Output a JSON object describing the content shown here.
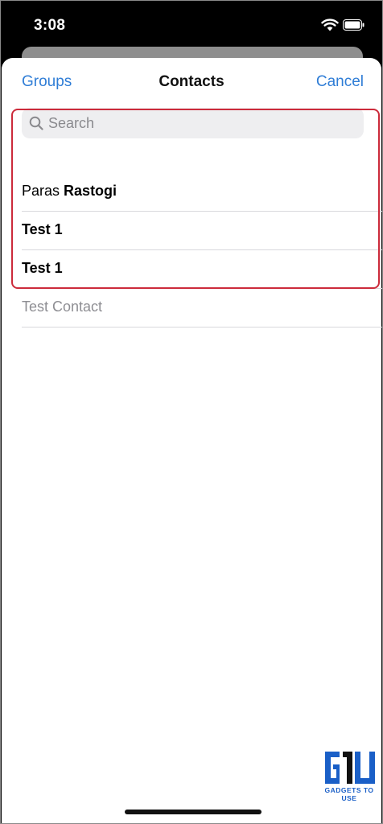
{
  "status_bar": {
    "time": "3:08",
    "icons": [
      "wifi-icon",
      "battery-icon"
    ]
  },
  "nav": {
    "left_label": "Groups",
    "title": "Contacts",
    "right_label": "Cancel"
  },
  "search": {
    "placeholder": "Search",
    "value": ""
  },
  "contacts": [
    {
      "first": "Paras",
      "last": "Rastogi"
    },
    {
      "first": "",
      "last": "Test 1"
    },
    {
      "first": "",
      "last": "Test 1"
    },
    {
      "first": "Test Contact",
      "last": "",
      "muted": true
    }
  ],
  "watermark": {
    "text": "GADGETS TO USE",
    "logo": "G1U"
  },
  "colors": {
    "accent": "#2f7dd6",
    "highlight": "#cc2b3b",
    "muted_text": "#8e8e93"
  }
}
